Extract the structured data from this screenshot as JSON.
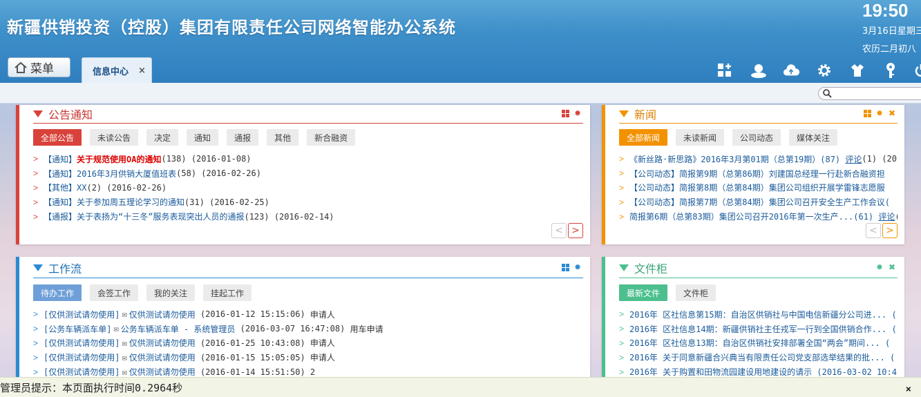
{
  "app": {
    "title": "新疆供销投资（控股）集团有限责任公司网络智能办公系统",
    "time": "19:50",
    "date": "3月16日星期三",
    "lunar": "农历二月初八"
  },
  "nav": {
    "menu_label": "菜单",
    "tabs": [
      {
        "label": "信息中心",
        "close": "×"
      }
    ],
    "tool_icons": [
      "add-app-icon",
      "user-icon",
      "cloud-upload-icon",
      "gear-icon",
      "shirt-icon",
      "key-icon",
      "power-icon"
    ]
  },
  "colors": {
    "header": "#3d8fc9",
    "notice": "#d9423a",
    "news": "#f39200",
    "workflow": "#2a8ad4",
    "files": "#4cbf8e"
  },
  "notice": {
    "title": "公告通知",
    "filters": [
      "全部公告",
      "未读公告",
      "决定",
      "通知",
      "通报",
      "其他",
      "新合融资"
    ],
    "items": [
      {
        "tag": "【通知】",
        "text": "关于规范使用OA的通知",
        "meta": "(138)  (2016-01-08)",
        "highlight": true
      },
      {
        "tag": "【通知】",
        "text": "2016年3月供销大厦值班表",
        "meta": "(58)  (2016-02-26)",
        "highlight": false
      },
      {
        "tag": "【其他】",
        "text": "XX",
        "meta": "(2)  (2016-02-26)",
        "highlight": false
      },
      {
        "tag": "【通知】",
        "text": "关于参加周五理论学习的通知",
        "meta": "(31)  (2016-02-25)",
        "highlight": false
      },
      {
        "tag": "【通报】",
        "text": "关于表扬为“十三冬”服务表现突出人员的通报",
        "meta": "(123)  (2016-02-14)",
        "highlight": false
      }
    ],
    "prev": "<",
    "next": ">"
  },
  "news": {
    "title": "新闻",
    "filters": [
      "全部新闻",
      "未读新闻",
      "公司动态",
      "媒体关注"
    ],
    "items": [
      {
        "text": "《新丝路·新思路》2016年3月第01期（总第19期）(87)",
        "link": "评论",
        "tail": "(1)  (201"
      },
      {
        "text": "【公司动态】简报第9期（总第86期）刘建国总经理一行赴新合融资担",
        "link": "",
        "tail": ""
      },
      {
        "text": "【公司动态】简报第8期（总第84期）集团公司组织开展学雷锋志愿服",
        "link": "",
        "tail": ""
      },
      {
        "text": "【公司动态】简报第7期（总第84期）集团公司召开安全生产工作会议(",
        "link": "",
        "tail": ""
      },
      {
        "text": "简报第6期（总第83期）集团公司召开2016年第一次生产...(61)",
        "link": "评论",
        "tail": "("
      }
    ],
    "prev": "<",
    "next": ">"
  },
  "workflow": {
    "title": "工作流",
    "filters": [
      "待办工作",
      "会签工作",
      "我的关注",
      "挂起工作"
    ],
    "items": [
      {
        "tag": "[仅供测试请勿使用]",
        "text": "仅供测试请勿使用",
        "meta": "(2016-01-12 15:15:06)",
        "tail": "申请人"
      },
      {
        "tag": "[公务车辆派车单]",
        "text": "公务车辆派车单 - 系统管理员",
        "meta": "(2016-03-07 16:47:08)",
        "tail": "用车申请"
      },
      {
        "tag": "[仅供测试请勿使用]",
        "text": "仅供测试请勿使用",
        "meta": "(2016-01-25 10:43:08)",
        "tail": "申请人"
      },
      {
        "tag": "[仅供测试请勿使用]",
        "text": "仅供测试请勿使用",
        "meta": "(2016-01-15 15:05:05)",
        "tail": "申请人"
      },
      {
        "tag": "[仅供测试请勿使用]",
        "text": "仅供测试请勿使用",
        "meta": "(2016-01-14 15:51:50)",
        "tail": "2"
      }
    ]
  },
  "files": {
    "title": "文件柜",
    "filters": [
      "最新文件",
      "文件柜"
    ],
    "items": [
      {
        "text": "2016年  区社信息第15期：自治区供销社与中国电信新疆分公司进...  ("
      },
      {
        "text": "2016年  区社信息14期：新疆供销社主任戎军一行到全国供销合作...  ("
      },
      {
        "text": "2016年  区社信息13期：自治区供销社安排部署全国“两会”期间...  ("
      },
      {
        "text": "2016年  关于同意新疆合兴典当有限责任公司党支部选举结果的批...  ("
      },
      {
        "text": "2016年  关于购置和田物流园建设用地建设的请示  (2016-03-02 10:41:"
      }
    ]
  },
  "status": {
    "text": "管理员提示：本页面执行时间0.2964秒",
    "close": "×"
  }
}
